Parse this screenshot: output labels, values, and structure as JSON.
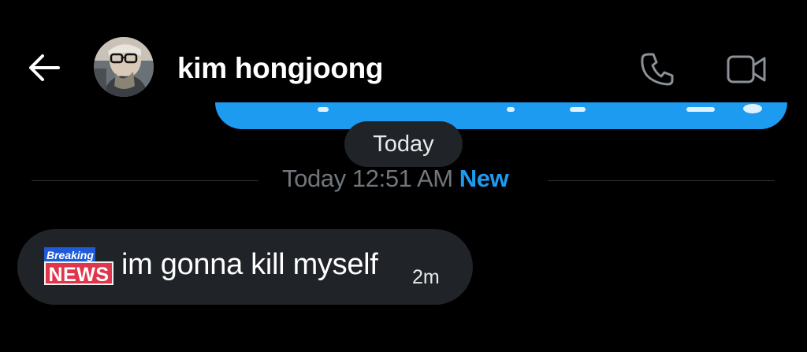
{
  "header": {
    "back_icon": "arrow-left-icon",
    "contact_name": "kim hongjoong",
    "call_icon": "phone-icon",
    "video_icon": "video-camera-icon"
  },
  "conversation": {
    "date_pill": "Today",
    "separator": {
      "time": "Today 12:51 AM",
      "new_label": "New"
    },
    "received_message": {
      "sticker_top": "Breaking",
      "sticker_bottom": "NEWS",
      "text": "im gonna kill myself",
      "time": "2m"
    }
  },
  "colors": {
    "background": "#000000",
    "accent": "#1d9bf0",
    "bubble_received": "#202327",
    "muted_text": "#71767b",
    "primary_text": "#e7e9ea"
  }
}
